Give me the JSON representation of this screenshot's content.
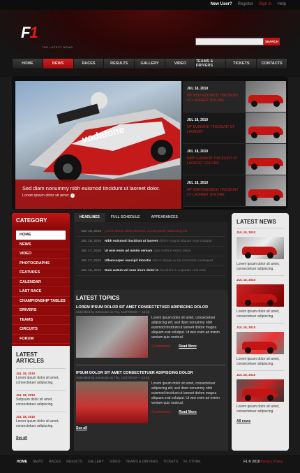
{
  "topbar": {
    "new_user": "New User?",
    "register": "Register",
    "sign_in": "Sign In",
    "help": "Help"
  },
  "header": {
    "logo_f": "F",
    "logo_1": "1",
    "tagline": "THE LATEST NEWS",
    "search_button": "SEARCH"
  },
  "nav": [
    "HOME",
    "NEWS",
    "RACES",
    "RESULTS",
    "GALLERY",
    "VIDEO",
    "TEAMS & DRIVERS",
    "TICKETS",
    "CONTACTS"
  ],
  "nav_active": "NEWS",
  "slider": {
    "caption_title": "Sed diam nonummy nibh euismod tincidunt ut laoreet dolor.",
    "caption_sub": "Lorem ipsum dolor sit amet",
    "items": [
      {
        "date": "JUL 18, 2010",
        "headline": "MY NIBH EUISMOD TINCIDUNT UT LAOREET DOLORE"
      },
      {
        "date": "JUL 18, 2010",
        "headline": "MY EUISMOD TINCIDUNT UT LAOREET"
      },
      {
        "date": "JUL 18, 2010",
        "headline": "NIBH EUISMOD TINCIDUNT UT LAOREET DOLORE"
      },
      {
        "date": "JUL 18, 2010",
        "headline": "MY NIBH EUISMOD TINCIDUNT UT LAOREET DOLORE"
      }
    ]
  },
  "category": {
    "title": "CATEGORY",
    "items": [
      "HOME",
      "NEWS",
      "VIDEO",
      "PHOTOGRAPHS",
      "FEATURES",
      "CALENDAR",
      "LAST RACE",
      "CHAMPIONSHIP TABLES",
      "DRIVERS",
      "TEAMS",
      "CIRCUITS",
      "FORUM"
    ]
  },
  "latest_articles": {
    "title": "LATEST ARTICLES",
    "items": [
      {
        "date": "JUL 18, 2010",
        "text": "Lorem ipsum dolor sit amet, consectetuer adipiscing."
      },
      {
        "date": "JUL 18, 2010",
        "text": "Setpsum dolor sit amet, consectetuer adipiscing."
      },
      {
        "date": "JUL 18, 2010",
        "text": "Lorem ipsum dolor sit amet, consectetuer adipiscing."
      }
    ],
    "see_all": "See all"
  },
  "tabs": [
    "HEADLINES",
    "FULL SCHEDULE",
    "APPEARANCES"
  ],
  "headlines": [
    {
      "date": "JUL 18, 2010",
      "bold": "Lorem ipsum dolor sit amet, consectetuer adipiscing elit",
      "normal": ""
    },
    {
      "date": "JUL 18, 2010",
      "bold": "Nibh euismod tincidunt ut laoreet",
      "normal": "dolore magna aliquam erat volutpat"
    },
    {
      "date": "JUL 17, 2010",
      "bold": "Ut wisi enim ad minim veniam",
      "normal": "quis nostrud exerci tation"
    },
    {
      "date": "JUL 17, 2010",
      "bold": "Ullamcorper suscipit lobortis",
      "normal": "nisl ut aliquip ex ea commodo consequat"
    },
    {
      "date": "JUL 16, 2010",
      "bold": "Duis autem vel eum iriure dolor in",
      "normal": "hendrerit in vulputate velit esse"
    }
  ],
  "topics": {
    "title": "LATEST TOPICS",
    "items": [
      {
        "title": "LOREM IPSUM DOLOR SIT AMET CONSECTETUER  ADIPISCING DOLOR",
        "by": "Submitted by Someone on Thu, 12/27/2010 — 12:45",
        "text": "Lorem ipsum dolor sit amet, consectetuer adipiscing elit, sed diam nonummy nibh euismod tincidunt ut laoreet dolore magna aliquam erat volutpat. Ut wisi enim ad minim veniam quis nostrud.",
        "comments": "2 comments",
        "read_more": "Read More"
      },
      {
        "title": "IPSUM DOLOR SIT AMET CONSECTETUER  ADIPISCING DOLOR",
        "by": "Submitted by Someone on Thu, 12/27/2010 — 12:45",
        "text": "Lorem ipsum dolor sit amet, consectetuer adipiscing elit, sed diam nonummy nibh euismod tincidunt ut laoreet dolore magna aliquam erat volutpat. Ut wisi enim ad minim veniam quis nostrud.",
        "comments": "2 comments",
        "read_more": "Read More"
      }
    ],
    "see_all": "See all"
  },
  "latest_news": {
    "title": "LATEST NEWS",
    "items": [
      {
        "date": "JUL 18, 2010",
        "text": "Lorem ipsum dolor sit amet, consectetuer adipiscing."
      },
      {
        "date": "JUL 18, 2010",
        "text": "Lorem ipsum dolor sit amet, consectetuer adipiscing."
      },
      {
        "date": "JUL 18, 2010",
        "text": "Lorem ipsum dolor sit amet, consectetuer adipiscing."
      },
      {
        "date": "JUL 18, 2010",
        "text": "Lorem ipsum dolor sit amet, consectetuer adipiscing."
      }
    ],
    "all_news": "All news"
  },
  "footer": {
    "nav": [
      "HOME",
      "NEWS",
      "RACES",
      "RESULTS",
      "GALLERY",
      "VIDEO",
      "TEAMS & DRIVERS",
      "TICKETS",
      "F1 STORE"
    ],
    "copyright": "F1 © 2010",
    "privacy": "Privacy Policy"
  },
  "colors": {
    "accent": "#d42020",
    "dark_bg": "#1b1b1b",
    "panel": "#eaeaea"
  }
}
